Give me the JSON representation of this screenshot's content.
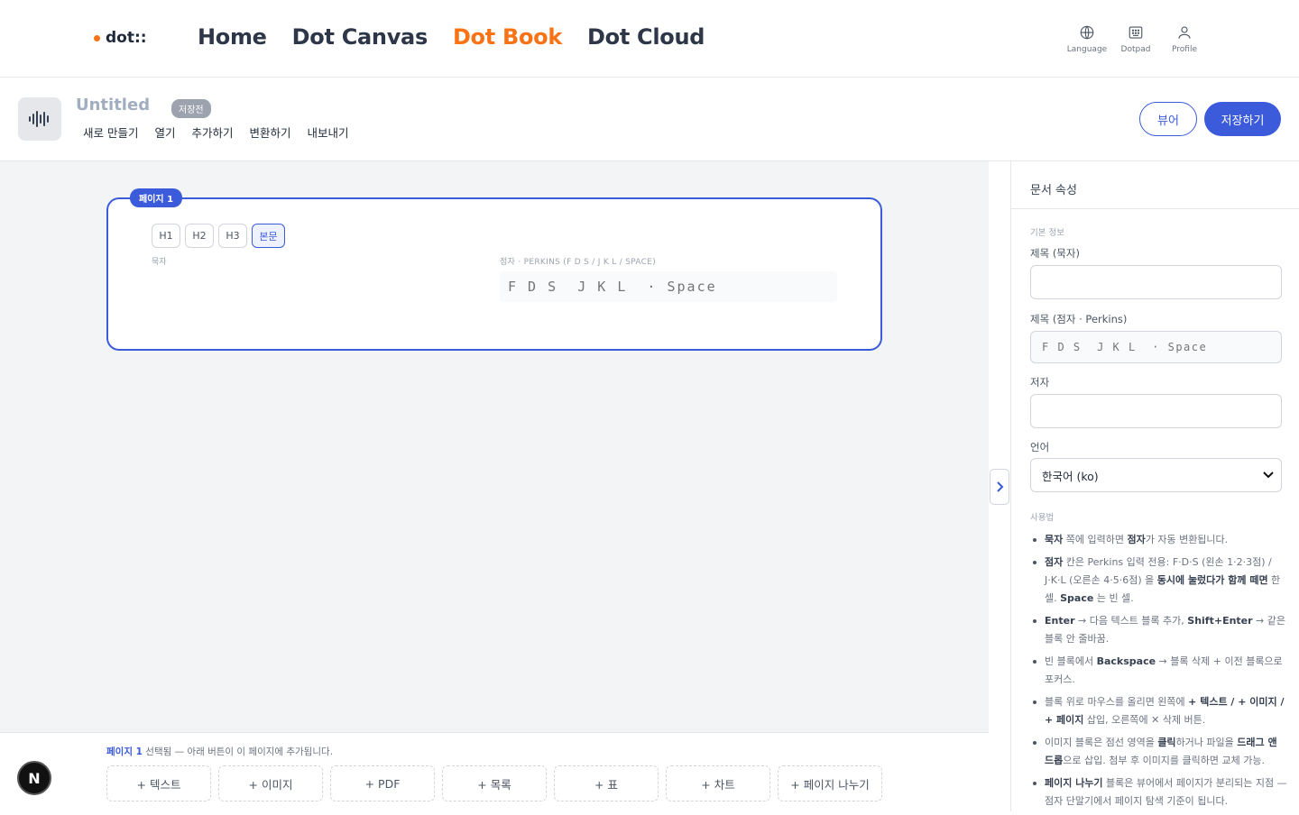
{
  "brand": {
    "logo_text": "dot::",
    "accent_color": "#f97316",
    "primary_color": "#3b5bdb"
  },
  "nav": {
    "links": [
      {
        "label": "Home",
        "active": false
      },
      {
        "label": "Dot Canvas",
        "active": false
      },
      {
        "label": "Dot Book",
        "active": true
      },
      {
        "label": "Dot Cloud",
        "active": false
      }
    ],
    "utilities": [
      {
        "label": "Language",
        "icon": "globe-icon"
      },
      {
        "label": "Dotpad",
        "icon": "dotpad-icon"
      },
      {
        "label": "Profile",
        "icon": "user-icon"
      }
    ]
  },
  "document": {
    "title": "Untitled",
    "status_badge": "저장전",
    "menu": [
      "새로 만들기",
      "열기",
      "추가하기",
      "변환하기",
      "내보내기"
    ],
    "viewer_label": "뷰어",
    "save_label": "저장하기"
  },
  "editor": {
    "page_tag": "페이지 1",
    "heading_buttons": [
      "H1",
      "H2",
      "H3",
      "본문"
    ],
    "active_heading": "본문",
    "ink_label": "묵자",
    "braille_label": "점자 · PERKINS (F D S / J K L / SPACE)",
    "braille_placeholder": "F D S  J K L  · Space"
  },
  "bottom": {
    "selected_page": "페이지 1",
    "selected_note": " 선택됨 — 아래 버튼이 이 페이지에 추가됩니다.",
    "add_buttons": [
      "+ 텍스트",
      "+ 이미지",
      "+ PDF",
      "+ 목록",
      "+ 표",
      "+ 차트",
      "+ 페이지 나누기"
    ],
    "badge": "N"
  },
  "panel": {
    "title": "문서 속성",
    "basic_info_label": "기본 정보",
    "title_ink_label": "제목 (묵자)",
    "title_ink_value": "",
    "title_braille_label": "제목 (점자 · Perkins)",
    "title_braille_placeholder": "F D S  J K L  · Space",
    "author_label": "저자",
    "author_value": "",
    "language_label": "언어",
    "language_value": "한국어 (ko)",
    "usage_label": "사용법"
  }
}
